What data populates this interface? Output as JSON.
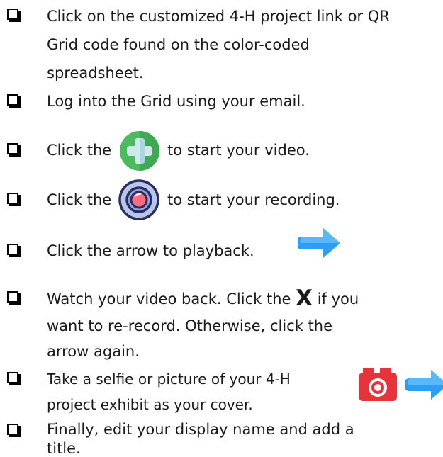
{
  "checklist": {
    "item1": {
      "line1": "Click on the customized 4-H project link or QR",
      "line2": "Grid code found on the color-coded",
      "line3": "spreadsheet."
    },
    "item2": {
      "line1": "Log into the Grid using your email."
    },
    "item3": {
      "before": "Click the",
      "after": "to start your video.",
      "icon": "plus-button-icon",
      "icon_color": "#4cbb5f"
    },
    "item4": {
      "before": "Click the",
      "after": "to start your recording.",
      "icon": "record-button-icon",
      "icon_color": "#ff6b81"
    },
    "item5": {
      "line1": "Click the arrow to playback.",
      "icon": "arrow-right-icon",
      "icon_color": "#2f9df3"
    },
    "item6": {
      "before": "Watch your video back. Click the",
      "x_symbol": "X",
      "after": "if you",
      "line2": "want to re-record. Otherwise, click the",
      "line3": "arrow again."
    },
    "item7": {
      "line1": "Take a selfie or picture of your 4-H",
      "line2": "project exhibit as your cover.",
      "icons": [
        "camera-icon",
        "arrow-right-icon"
      ],
      "camera_color": "#e8323c"
    },
    "item8": {
      "line1": "Finally, edit your display name and add a",
      "line2": "title."
    }
  }
}
